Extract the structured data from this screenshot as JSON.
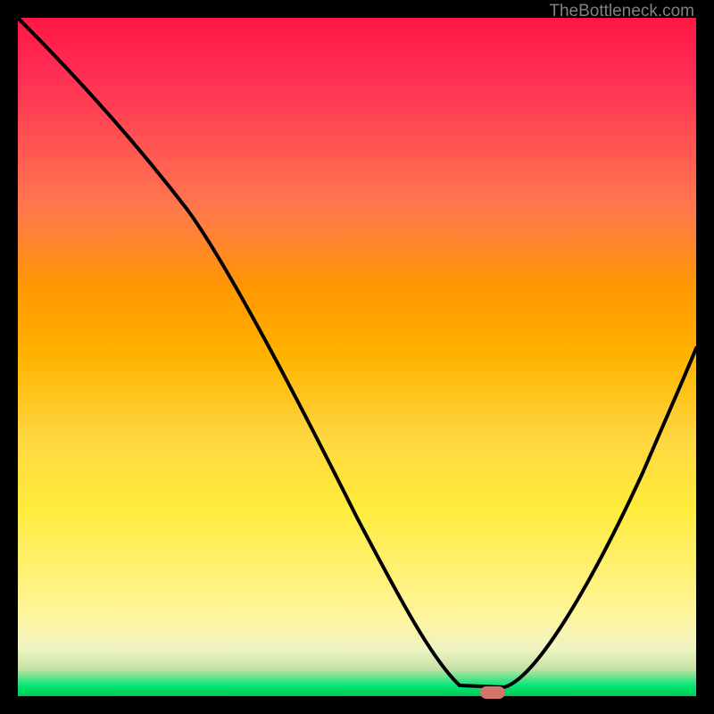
{
  "watermark": "TheBottleneck.com",
  "colors": {
    "background": "#000000",
    "stroke": "#000000",
    "marker": "#d4746a"
  },
  "chart_data": {
    "type": "line",
    "title": "",
    "x": [
      0.0,
      0.08,
      0.16,
      0.24,
      0.33,
      0.42,
      0.5,
      0.56,
      0.62,
      0.67,
      0.72,
      0.78,
      0.84,
      0.9,
      0.95,
      1.0
    ],
    "values": [
      1.0,
      0.9,
      0.8,
      0.71,
      0.57,
      0.42,
      0.28,
      0.17,
      0.07,
      0.02,
      0.0,
      0.04,
      0.14,
      0.27,
      0.4,
      0.53
    ],
    "series_description": "Bottleneck curve — high (red) at left, descends to near-zero (green) around x≈0.70, rises again toward right edge",
    "ylim": [
      0,
      1
    ],
    "xlim": [
      0,
      1
    ],
    "xlabel": "",
    "ylabel": "",
    "gradient_stops": [
      {
        "pos": 0.0,
        "color": "#ff1744"
      },
      {
        "pos": 0.4,
        "color": "#ff9800"
      },
      {
        "pos": 0.72,
        "color": "#ffeb3b"
      },
      {
        "pos": 0.985,
        "color": "#00e676"
      },
      {
        "pos": 1.0,
        "color": "#00c853"
      }
    ],
    "marker": {
      "x_frac": 0.7,
      "y_frac": 0.995
    }
  }
}
